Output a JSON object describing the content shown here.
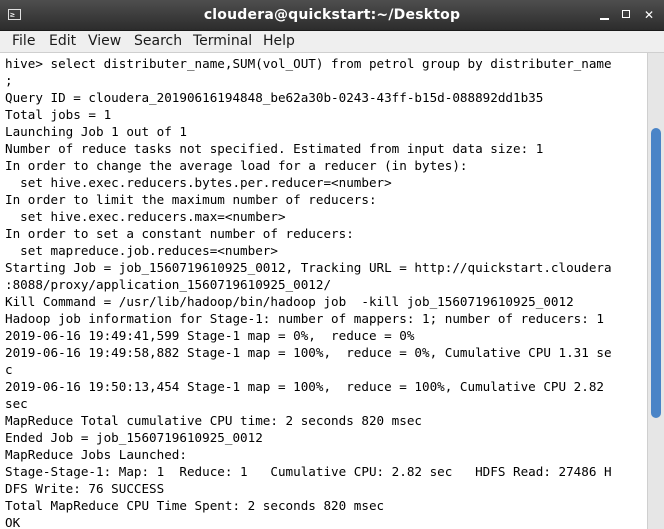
{
  "window": {
    "title": "cloudera@quickstart:~/Desktop",
    "app_icon_glyph": "≥",
    "buttons": {
      "close_glyph": "✕"
    }
  },
  "menu": {
    "items": [
      "File",
      "Edit",
      "View",
      "Search",
      "Terminal",
      "Help"
    ]
  },
  "terminal": {
    "lines": [
      "hive> select distributer_name,SUM(vol_OUT) from petrol group by distributer_name",
      ";",
      "Query ID = cloudera_20190616194848_be62a30b-0243-43ff-b15d-088892dd1b35",
      "Total jobs = 1",
      "Launching Job 1 out of 1",
      "Number of reduce tasks not specified. Estimated from input data size: 1",
      "In order to change the average load for a reducer (in bytes):",
      "  set hive.exec.reducers.bytes.per.reducer=<number>",
      "In order to limit the maximum number of reducers:",
      "  set hive.exec.reducers.max=<number>",
      "In order to set a constant number of reducers:",
      "  set mapreduce.job.reduces=<number>",
      "Starting Job = job_1560719610925_0012, Tracking URL = http://quickstart.cloudera",
      ":8088/proxy/application_1560719610925_0012/",
      "Kill Command = /usr/lib/hadoop/bin/hadoop job  -kill job_1560719610925_0012",
      "Hadoop job information for Stage-1: number of mappers: 1; number of reducers: 1",
      "2019-06-16 19:49:41,599 Stage-1 map = 0%,  reduce = 0%",
      "2019-06-16 19:49:58,882 Stage-1 map = 100%,  reduce = 0%, Cumulative CPU 1.31 se",
      "c",
      "2019-06-16 19:50:13,454 Stage-1 map = 100%,  reduce = 100%, Cumulative CPU 2.82",
      "sec",
      "MapReduce Total cumulative CPU time: 2 seconds 820 msec",
      "Ended Job = job_1560719610925_0012",
      "MapReduce Jobs Launched:",
      "Stage-Stage-1: Map: 1  Reduce: 1   Cumulative CPU: 2.82 sec   HDFS Read: 27486 H",
      "DFS Write: 76 SUCCESS",
      "Total MapReduce CPU Time Spent: 2 seconds 820 msec",
      "OK"
    ]
  },
  "scrollbar": {
    "position_fraction": 0.4,
    "thumb_color": "#4a84c7"
  }
}
